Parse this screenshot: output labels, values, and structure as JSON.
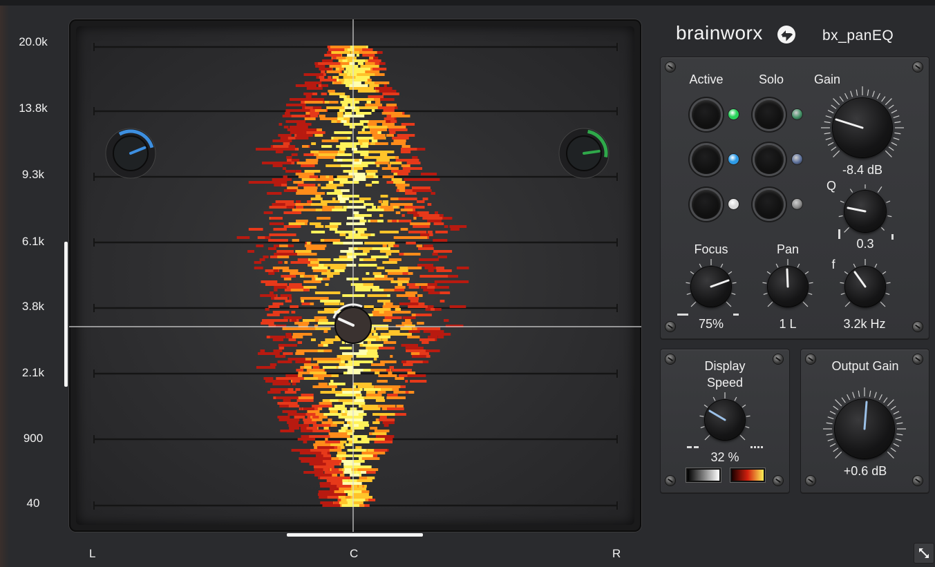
{
  "header": {
    "brand": "brainworx",
    "product": "bx_panEQ"
  },
  "frequency_axis": {
    "labels": [
      "20.0k",
      "13.8k",
      "9.3k",
      "6.1k",
      "3.8k",
      "2.1k",
      "900",
      "40"
    ]
  },
  "pan_axis": {
    "left": "L",
    "center": "C",
    "right": "R"
  },
  "band_panel": {
    "active_label": "Active",
    "solo_label": "Solo",
    "gain_label": "Gain",
    "gain_value": "-8.4 dB",
    "q_label": "Q",
    "q_value": "0.3",
    "focus_label": "Focus",
    "focus_value": "75%",
    "pan_label": "Pan",
    "pan_value": "1 L",
    "f_label": "f",
    "f_value": "3.2k Hz",
    "bands": [
      {
        "led_color": "#29d35a"
      },
      {
        "led_color": "#2d9ae6"
      },
      {
        "led_color": "#d9d9d9"
      }
    ],
    "solo_led_colors": [
      "#3e8f63",
      "#5a6e9a",
      "#8a8a8a"
    ]
  },
  "display_speed_panel": {
    "title_line1": "Display",
    "title_line2": "Speed",
    "value": "32 %",
    "colors": {
      "mono_from": "#000000",
      "mono_to": "#ffffff",
      "heat_from": "#1a0000",
      "heat_to": "#ffee55"
    }
  },
  "output_panel": {
    "title": "Output Gain",
    "value": "+0.6 dB"
  },
  "colors": {
    "band_blue": "#3d8fe0",
    "band_green": "#2fa84a"
  }
}
